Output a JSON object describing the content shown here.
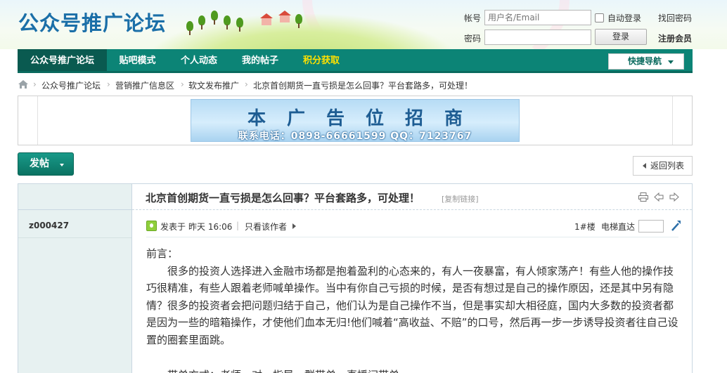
{
  "site": {
    "logo_text": "公众号推广论坛"
  },
  "login": {
    "username_label": "帐号",
    "username_placeholder": "用户名/Email",
    "autologin_label": "自动登录",
    "forgot_label": "找回密码",
    "password_label": "密码",
    "login_button": "登录",
    "register_label": "注册会员"
  },
  "nav": {
    "items": [
      {
        "label": "公众号推广论坛"
      },
      {
        "label": "贴吧模式"
      },
      {
        "label": "个人动态"
      },
      {
        "label": "我的帖子"
      },
      {
        "label": "积分获取"
      }
    ],
    "quick_nav": "快捷导航"
  },
  "breadcrumb": {
    "items": [
      "公众号推广论坛",
      "营销推广信息区",
      "软文发布推广",
      "北京首创期货一直亏损是怎么回事？平台套路多，可处理！"
    ]
  },
  "ad": {
    "headline": "本广告位招商",
    "contact": "联系电话：0898-66661599  QQ：7123767"
  },
  "actions": {
    "post_button": "发帖",
    "back_button": "返回列表"
  },
  "thread": {
    "title": "北京首创期货一直亏损是怎么回事？平台套路多，可处理！",
    "copy_link": "[复制链接]",
    "author": "z000427",
    "posted_label": "发表于",
    "posted_time": "昨天 16:06",
    "author_only": "只看该作者",
    "floor": "1#楼",
    "jump_label": "电梯直达",
    "body": {
      "intro": "前言：",
      "paragraph1": "很多的投资人选择进入金融市场都是抱着盈利的心态来的，有人一夜暴富，有人倾家荡产！有些人他的操作技巧很精准，有些人跟着老师喊单操作。当中有你自己亏损的时候，是否有想过是自己的操作原因，还是其中另有隐情？很多的投资者会把问题归结于自己，他们认为是自己操作不当，但是事实却大相径庭，国内大多数的投资者都是因为一些的暗箱操作，才使他们血本无归!他们喊着“高收益、不赔”的口号，然后再一步一步诱导投资者往自己设置的圈套里面跳。",
      "paragraph2": "带单方式：老师一对一指导、群带单、直播间带单"
    }
  },
  "colors": {
    "nav_bg": "#0c8476",
    "nav_active": "#0a5a50",
    "logo": "#1b6fa8",
    "gold": "#ffe100",
    "aside_bg": "#e7f1f1"
  }
}
